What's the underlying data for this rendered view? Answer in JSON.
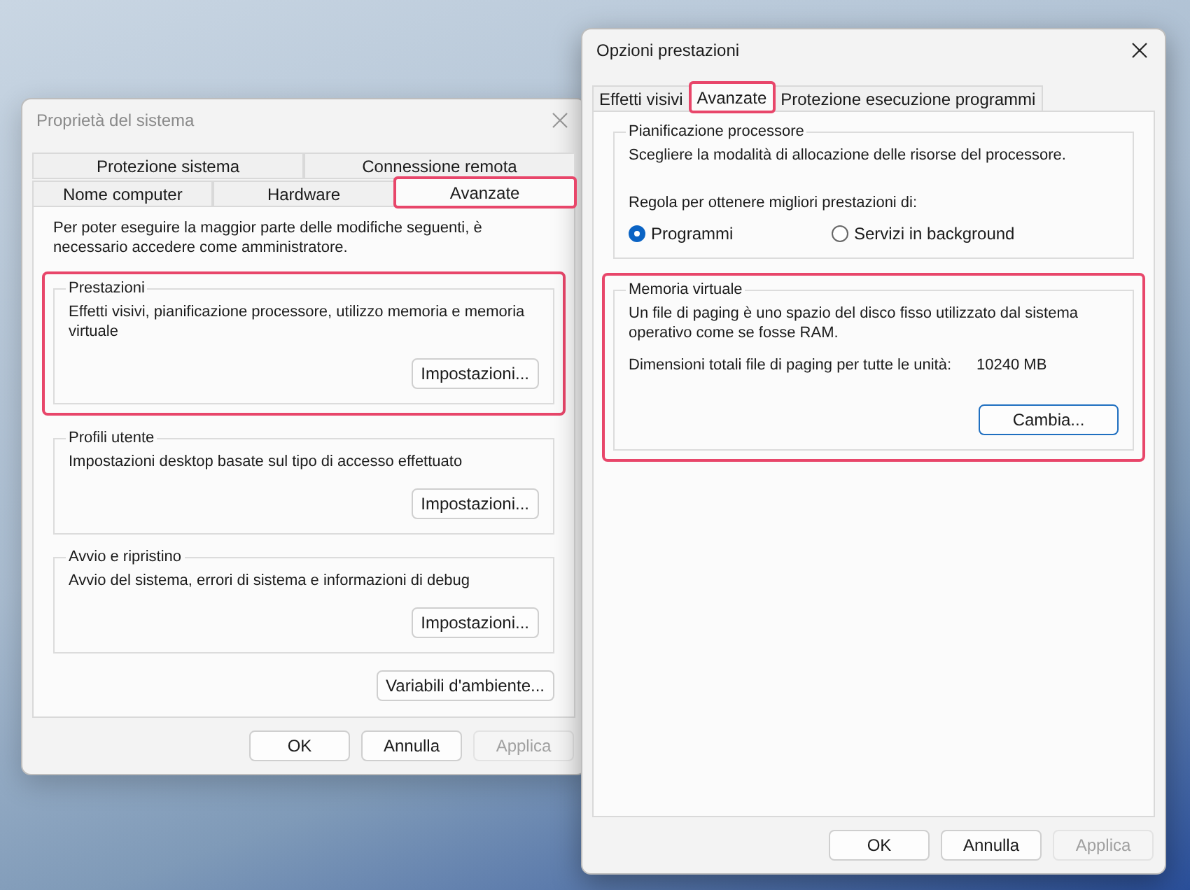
{
  "windows": [
    {
      "title": "Proprietà del sistema",
      "active": false,
      "tab_rows": [
        [
          {
            "label": "Protezione sistema",
            "selected": false,
            "highlighted": false
          },
          {
            "label": "Connessione remota",
            "selected": false,
            "highlighted": false
          }
        ],
        [
          {
            "label": "Nome computer",
            "selected": false,
            "highlighted": false
          },
          {
            "label": "Hardware",
            "selected": false,
            "highlighted": false
          },
          {
            "label": "Avanzate",
            "selected": true,
            "highlighted": true
          }
        ]
      ],
      "note": "Per poter eseguire la maggior parte delle modifiche seguenti, è necessario accedere come amministratore.",
      "groups": [
        {
          "kind": "settings",
          "title": "Prestazioni",
          "highlighted": true,
          "text": "Effetti visivi, pianificazione processore, utilizzo memoria e memoria virtuale",
          "button": {
            "label": "Impostazioni...",
            "default": false
          }
        },
        {
          "kind": "settings",
          "title": "Profili utente",
          "highlighted": false,
          "text": "Impostazioni desktop basate sul tipo di accesso effettuato",
          "button": {
            "label": "Impostazioni...",
            "default": false
          }
        },
        {
          "kind": "settings",
          "title": "Avvio e ripristino",
          "highlighted": false,
          "text": "Avvio del sistema, errori di sistema e informazioni di debug",
          "button": {
            "label": "Impostazioni...",
            "default": false
          }
        }
      ],
      "extra_button": "Variabili d'ambiente...",
      "buttons": [
        {
          "label": "OK",
          "disabled": false
        },
        {
          "label": "Annulla",
          "disabled": false
        },
        {
          "label": "Applica",
          "disabled": true
        }
      ]
    },
    {
      "title": "Opzioni prestazioni",
      "active": true,
      "tab_rows": [
        [
          {
            "label": "Effetti visivi",
            "selected": false,
            "highlighted": false
          },
          {
            "label": "Avanzate",
            "selected": true,
            "highlighted": true
          },
          {
            "label": "Protezione esecuzione programmi",
            "selected": false,
            "highlighted": false
          }
        ]
      ],
      "groups": [
        {
          "kind": "radios",
          "title": "Pianificazione processore",
          "highlighted": false,
          "text": "Scegliere la modalità di allocazione delle risorse del processore.",
          "prompt": "Regola per ottenere migliori prestazioni di:",
          "options": [
            {
              "label": "Programmi",
              "selected": true
            },
            {
              "label": "Servizi in background",
              "selected": false
            }
          ]
        },
        {
          "kind": "memory",
          "title": "Memoria virtuale",
          "highlighted": true,
          "text": "Un file di paging è uno spazio del disco fisso utilizzato dal sistema operativo come se fosse RAM.",
          "size_label": "Dimensioni totali file di paging per tutte le unità:",
          "size_value": "10240 MB",
          "button": {
            "label": "Cambia...",
            "default": true
          }
        }
      ],
      "buttons": [
        {
          "label": "OK",
          "disabled": false
        },
        {
          "label": "Annulla",
          "disabled": false
        },
        {
          "label": "Applica",
          "disabled": true
        }
      ]
    }
  ]
}
